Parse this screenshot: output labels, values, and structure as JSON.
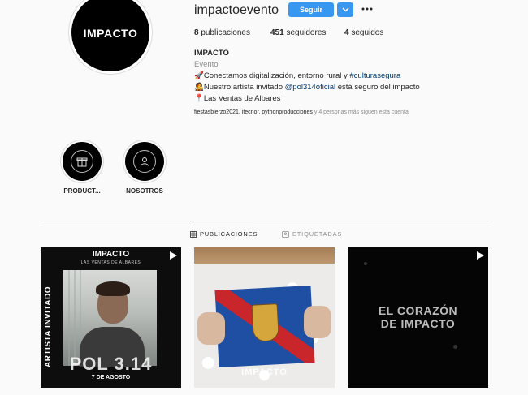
{
  "profile": {
    "username": "impactoevento",
    "avatar_text": "IMPACTO",
    "follow_label": "Seguir",
    "stats": [
      {
        "count": "8",
        "label": "publicaciones"
      },
      {
        "count": "451",
        "label": "seguidores"
      },
      {
        "count": "4",
        "label": "seguidos"
      }
    ],
    "bio": {
      "name": "IMPACTO",
      "category": "Evento",
      "line1_text": "Conectamos digitalización, entorno rural y ",
      "line1_tag": "#culturasegura",
      "line2_text_a": "Nuestro artista invitado ",
      "line2_mention": "@pol314oficial",
      "line2_text_b": " está seguro del impacto",
      "line3_text": "Las Ventas de Albares"
    },
    "followed_by": "fiestasbierzo2021, itecnor, pythonproducciones",
    "followed_more": " y 4 personas más siguen esta cuenta"
  },
  "highlights": [
    {
      "label": "PRODUCT..."
    },
    {
      "label": "NOSOTROS"
    }
  ],
  "tabs": [
    {
      "label": "PUBLICACIONES"
    },
    {
      "label": "ETIQUETADAS"
    }
  ],
  "posts": [
    {
      "logo": "IMPACTO",
      "subtitle": "LAS VENTAS DE ALBARES",
      "side_text": "ARTISTA INVITADO",
      "big_text": "POL 3.14",
      "date": "7 DE AGOSTO"
    },
    {
      "overlay_text": "IMPACTO"
    },
    {
      "line1": "EL CORAZÓN",
      "line2": "DE IMPACTO"
    }
  ]
}
